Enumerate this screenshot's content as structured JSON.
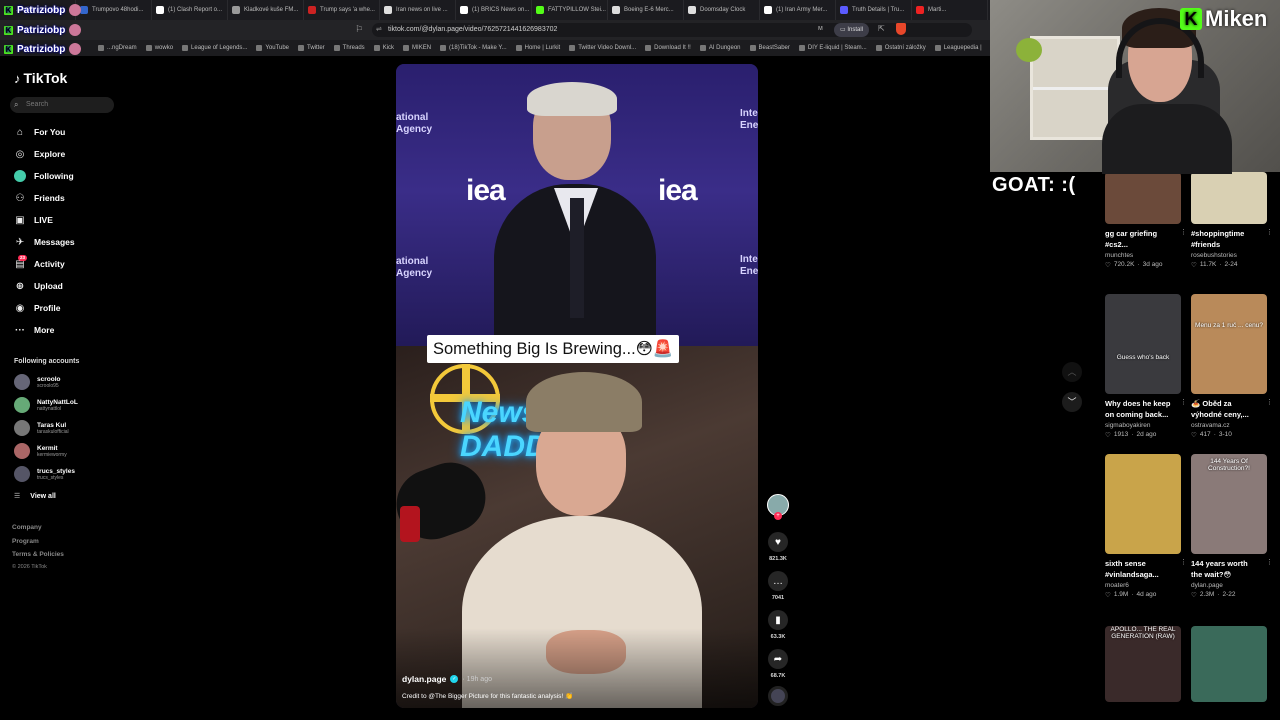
{
  "browser": {
    "tabs": [
      {
        "label": "...ovinky.cz - nej...",
        "color": "#3a6"
      },
      {
        "label": "Trumpovo 48hodi...",
        "color": "#36c"
      },
      {
        "label": "(1) Clash Report o...",
        "color": "#fff"
      },
      {
        "label": "Kladkové kuše FM...",
        "color": "#999"
      },
      {
        "label": "Trump says 'a whe...",
        "color": "#c22"
      },
      {
        "label": "Iran news on live ...",
        "color": "#ddd"
      },
      {
        "label": "(1) BRICS News on...",
        "color": "#fff"
      },
      {
        "label": "FATTYPILLOW Stei...",
        "color": "#53fc18"
      },
      {
        "label": "Boeing E-6 Merc...",
        "color": "#ddd"
      },
      {
        "label": "Doomsday Clock",
        "color": "#ddd"
      },
      {
        "label": "(1) Iran Army Mer...",
        "color": "#fff"
      },
      {
        "label": "Truth Details | Tru...",
        "color": "#5b5bff"
      },
      {
        "label": "Marti...",
        "color": "#e22"
      }
    ],
    "url": "tiktok.com/@dylan.page/video/7625721441626983702",
    "install_label": "Install",
    "bookmarks": [
      "...ngDream",
      "wowko",
      "League of Legends...",
      "YouTube",
      "Twitter",
      "Threads",
      "Kick",
      "MIKEN",
      "(18)TikTok - Make Y...",
      "Home | Lurkit",
      "Twitter Video Downl...",
      "Download It !!",
      "AI Dungeon",
      "BeastSaber",
      "DIY E-liquid | Steam...",
      "Ostatní záložky",
      "Leaguepedia |"
    ]
  },
  "stream_overlay": {
    "names": [
      "Patriziobp",
      "Patriziobp",
      "Patriziobp"
    ],
    "brand": "Miken",
    "brand_letter": "K",
    "goat_text": "GOAT: :("
  },
  "sidebar": {
    "logo": "TikTok",
    "search_placeholder": "Search",
    "nav": [
      {
        "label": "For You",
        "icon": "home-icon"
      },
      {
        "label": "Explore",
        "icon": "compass-icon"
      },
      {
        "label": "Following",
        "icon": "following-avatar-icon"
      },
      {
        "label": "Friends",
        "icon": "friends-icon"
      },
      {
        "label": "LIVE",
        "icon": "live-icon"
      },
      {
        "label": "Messages",
        "icon": "messages-icon"
      },
      {
        "label": "Activity",
        "icon": "activity-icon",
        "badge": "23"
      },
      {
        "label": "Upload",
        "icon": "upload-icon"
      },
      {
        "label": "Profile",
        "icon": "profile-icon"
      },
      {
        "label": "More",
        "icon": "more-icon"
      }
    ],
    "following_title": "Following accounts",
    "accounts": [
      {
        "name": "scroolo",
        "handle": "scroolo95"
      },
      {
        "name": "NattyNattLoL",
        "handle": "nattynattlol"
      },
      {
        "name": "Taras Kul",
        "handle": "taraskulofficial"
      },
      {
        "name": "Kermit",
        "handle": "kermiewormy"
      },
      {
        "name": "trucs_styles",
        "handle": "trucs_styles"
      }
    ],
    "view_all": "View all",
    "footer": [
      "Company",
      "Program",
      "Terms & Policies",
      "© 2026 TikTok"
    ]
  },
  "video": {
    "caption": "Something Big Is Brewing...😳🚨",
    "iea_text": "iea",
    "agency_text_left": "ational\nAgency",
    "agency_text_right": "Inter\nEne",
    "neon_text": "News\nDADDY",
    "author": "dylan.page",
    "posted": "· 19h ago",
    "description": "Credit to @The Bigger Picture for this fantastic analysis! 👏"
  },
  "actions": {
    "likes": "821.3K",
    "comments": "7041",
    "saves": "63.3K",
    "shares": "68.7K"
  },
  "recommended": [
    {
      "title": "gg car griefing #cs2...",
      "creator": "munchtes",
      "likes": "720.2K",
      "date": "3d ago",
      "thumb_color": "#6b4a3a",
      "thumb_text": ""
    },
    {
      "title": "#shoppingtime #friends",
      "creator": "rosebushstories",
      "likes": "11.7K",
      "date": "2-24",
      "thumb_color": "#d9d0b3",
      "thumb_text": ""
    },
    {
      "title": "Why does he keep on coming back...",
      "creator": "sigmaboyakiren",
      "likes": "1913",
      "date": "2d ago",
      "thumb_color": "#3a3a3e",
      "thumb_text": "Guess who's back"
    },
    {
      "title": "🍝 Oběd za výhodné ceny,...",
      "creator": "ostravama.cz",
      "likes": "417",
      "date": "3-10",
      "thumb_color": "#b98a5a",
      "thumb_text": "Menu za 1 ruč ... cenu?"
    },
    {
      "title": "sixth sense #vinlandsaga...",
      "creator": "moater6",
      "likes": "1.9M",
      "date": "4d ago",
      "thumb_color": "#c9a44a",
      "thumb_text": ""
    },
    {
      "title": "144 years worth the wait?😳",
      "creator": "dylan.page",
      "likes": "2.3M",
      "date": "2-22",
      "thumb_color": "#8a7a78",
      "thumb_text": "144 Years Of Construction?!"
    },
    {
      "title": "",
      "creator": "",
      "likes": "",
      "date": "",
      "thumb_color": "#3a2a2a",
      "thumb_text": "APOLLO... THE REAL GENERATION (RAW)"
    },
    {
      "title": "",
      "creator": "",
      "likes": "",
      "date": "",
      "thumb_color": "#3a6a5a",
      "thumb_text": ""
    }
  ]
}
